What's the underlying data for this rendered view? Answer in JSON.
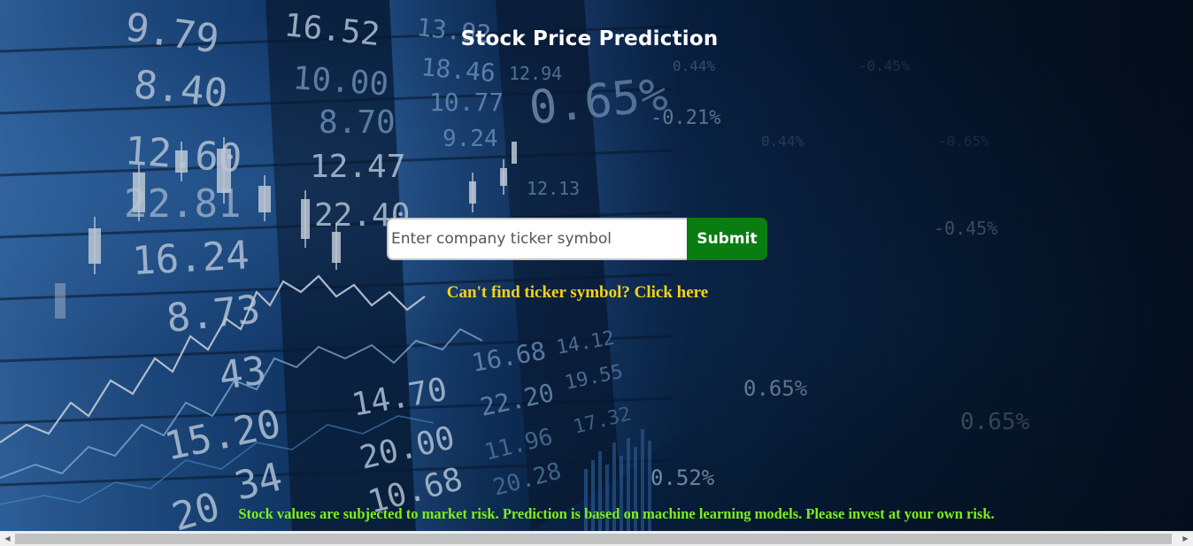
{
  "header": {
    "title": "Stock Price Prediction"
  },
  "search": {
    "placeholder": "Enter company ticker symbol",
    "value": "",
    "submit_label": "Submit"
  },
  "help_link": {
    "label": "Can't find ticker symbol? Click here"
  },
  "footer": {
    "disclaimer": "Stock values are subjected to market risk. Prediction is based on machine learning models. Please invest at your own risk."
  },
  "background": {
    "board_numbers": [
      "9.79",
      "8.40",
      "12.60",
      "22.81",
      "16.24",
      "8.73",
      "43",
      "15.20",
      "34",
      "20",
      "16.52",
      "10.00",
      "8.70",
      "12.47",
      "22.40",
      "14.70",
      "20.00",
      "10.68",
      "13.92",
      "18.46",
      "10.77",
      "9.24",
      "16.68",
      "22.20",
      "11.96",
      "20.28",
      "14.12",
      "19.55",
      "17.32",
      "12.94",
      "12.13"
    ],
    "percent_labels": [
      "0.65%",
      "-0.21%",
      "-0.45%",
      "0.65%",
      "0.65%",
      "0.52%",
      "0.44%"
    ],
    "colors": {
      "title": "#ffffff",
      "submit_bg": "#0a7d12",
      "link": "#f6d21a",
      "disclaimer": "#7cf01a"
    }
  },
  "scrollbar": {
    "left_arrow": "◀",
    "right_arrow": "▶"
  }
}
